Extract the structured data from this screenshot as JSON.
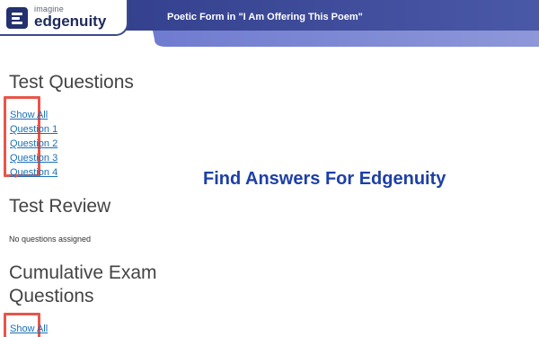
{
  "header": {
    "logo_small": "imagine",
    "logo_big": "edgenuity",
    "title": "Poetic Form in \"I Am Offering This Poem\""
  },
  "test_questions": {
    "heading": "Test Questions",
    "links": [
      "Show All",
      "Question 1",
      "Question 2",
      "Question 3",
      "Question 4"
    ]
  },
  "test_review": {
    "heading": "Test Review",
    "note": "No questions assigned"
  },
  "cumulative": {
    "heading_line1": "Cumulative Exam",
    "heading_line2": "Questions",
    "links": [
      "Show All"
    ]
  },
  "overlay": {
    "title": "Find Answers For Edgenuity"
  },
  "colors": {
    "header_gradient_start": "#3f4b9c",
    "header_gradient_end": "#6b79c8",
    "link": "#1a6fb8",
    "highlight_box": "#e8554a",
    "overlay_text": "#1d3fa8"
  }
}
